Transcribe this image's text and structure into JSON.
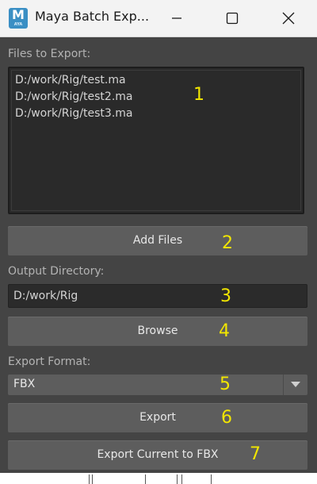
{
  "window": {
    "title": "Maya Batch Exp...",
    "app_icon_letter": "M",
    "app_icon_sub": "AYA"
  },
  "files_section": {
    "label": "Files to Export:",
    "files": [
      "D:/work/Rig/test.ma",
      "D:/work/Rig/test2.ma",
      "D:/work/Rig/test3.ma"
    ]
  },
  "add_files_label": "Add Files",
  "output": {
    "label": "Output Directory:",
    "value": "D:/work/Rig"
  },
  "browse_label": "Browse",
  "format": {
    "label": "Export Format:",
    "selected": "FBX"
  },
  "export_label": "Export",
  "export_current_label": "Export Current to FBX",
  "annotations": [
    "1",
    "2",
    "3",
    "4",
    "5",
    "6",
    "7"
  ],
  "colors": {
    "window_bg": "#444444",
    "button_bg": "#5d5d5d",
    "field_bg": "#2b2b2b",
    "annotation": "#f2e600",
    "maya_icon": "#3a8fc4"
  }
}
